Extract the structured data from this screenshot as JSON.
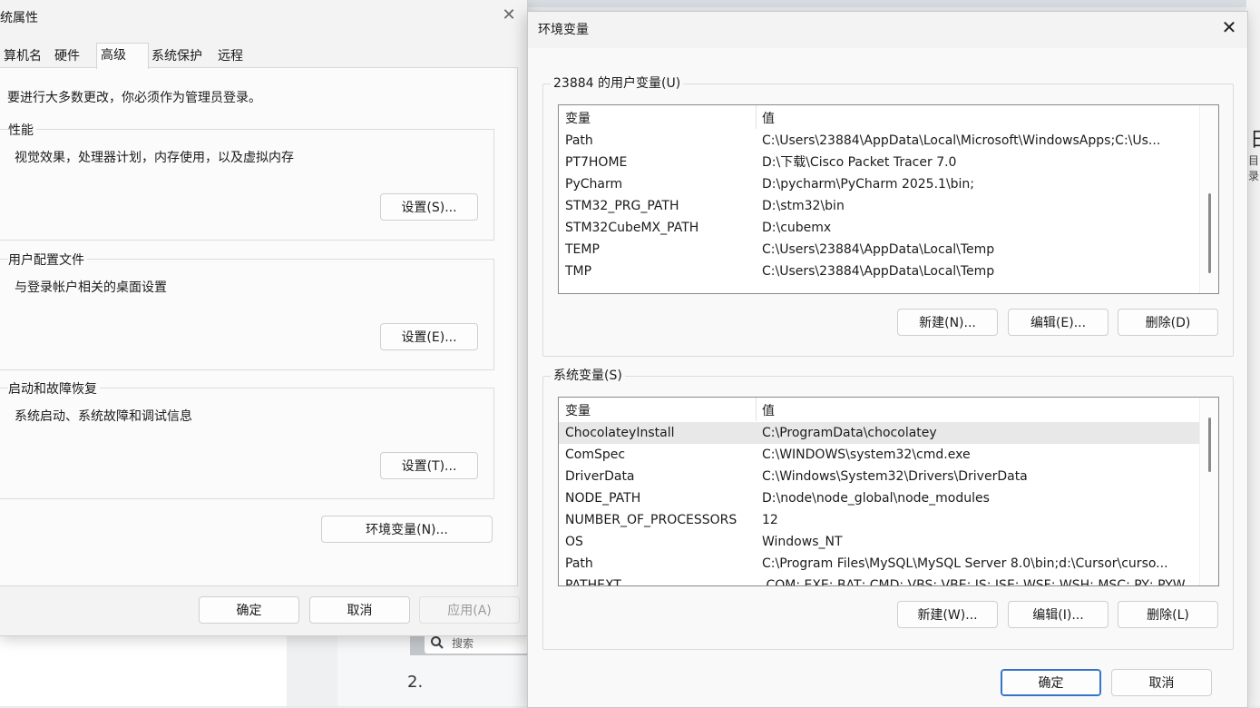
{
  "background": {
    "search_placeholder": "搜索",
    "list_number": "2.",
    "right_edge_glyph": "日",
    "right_edge_text": "目录"
  },
  "system_properties": {
    "title": "统属性",
    "tabs": [
      "算机名",
      "硬件",
      "高级",
      "系统保护",
      "远程"
    ],
    "active_tab": "高级",
    "admin_note": "要进行大多数更改，你必须作为管理员登录。",
    "performance": {
      "title": "性能",
      "description": "视觉效果，处理器计划，内存使用，以及虚拟内存",
      "button": "设置(S)..."
    },
    "user_profiles": {
      "title": "用户配置文件",
      "description": "与登录帐户相关的桌面设置",
      "button": "设置(E)..."
    },
    "startup_recovery": {
      "title": "启动和故障恢复",
      "description": "系统启动、系统故障和调试信息",
      "button": "设置(T)..."
    },
    "env_button": "环境变量(N)...",
    "ok": "确定",
    "cancel": "取消",
    "apply": "应用(A)"
  },
  "env_dialog": {
    "title": "环境变量",
    "user_vars": {
      "group_title": "23884 的用户变量(U)",
      "col_name": "变量",
      "col_value": "值",
      "rows": [
        {
          "name": "Path",
          "value": "C:\\Users\\23884\\AppData\\Local\\Microsoft\\WindowsApps;C:\\Us..."
        },
        {
          "name": "PT7HOME",
          "value": "D:\\下载\\Cisco Packet Tracer 7.0"
        },
        {
          "name": "PyCharm",
          "value": "D:\\pycharm\\PyCharm 2025.1\\bin;"
        },
        {
          "name": "STM32_PRG_PATH",
          "value": "D:\\stm32\\bin"
        },
        {
          "name": "STM32CubeMX_PATH",
          "value": "D:\\cubemx"
        },
        {
          "name": "TEMP",
          "value": "C:\\Users\\23884\\AppData\\Local\\Temp"
        },
        {
          "name": "TMP",
          "value": "C:\\Users\\23884\\AppData\\Local\\Temp"
        }
      ],
      "new_button": "新建(N)...",
      "edit_button": "编辑(E)...",
      "delete_button": "删除(D)"
    },
    "system_vars": {
      "group_title": "系统变量(S)",
      "col_name": "变量",
      "col_value": "值",
      "rows": [
        {
          "name": "ChocolateyInstall",
          "value": "C:\\ProgramData\\chocolatey"
        },
        {
          "name": "ComSpec",
          "value": "C:\\WINDOWS\\system32\\cmd.exe"
        },
        {
          "name": "DriverData",
          "value": "C:\\Windows\\System32\\Drivers\\DriverData"
        },
        {
          "name": "NODE_PATH",
          "value": "D:\\node\\node_global\\node_modules"
        },
        {
          "name": "NUMBER_OF_PROCESSORS",
          "value": "12"
        },
        {
          "name": "OS",
          "value": "Windows_NT"
        },
        {
          "name": "Path",
          "value": "C:\\Program Files\\MySQL\\MySQL Server 8.0\\bin;d:\\Cursor\\curso..."
        },
        {
          "name": "PATHEXT",
          "value": ".COM;.EXE;.BAT;.CMD;.VBS;.VBE;.JS;.JSE;.WSF;.WSH;.MSC;.PY;.PYW"
        }
      ],
      "selected_row": "ChocolateyInstall",
      "new_button": "新建(W)...",
      "edit_button": "编辑(I)...",
      "delete_button": "删除(L)"
    },
    "ok": "确定",
    "cancel": "取消"
  }
}
